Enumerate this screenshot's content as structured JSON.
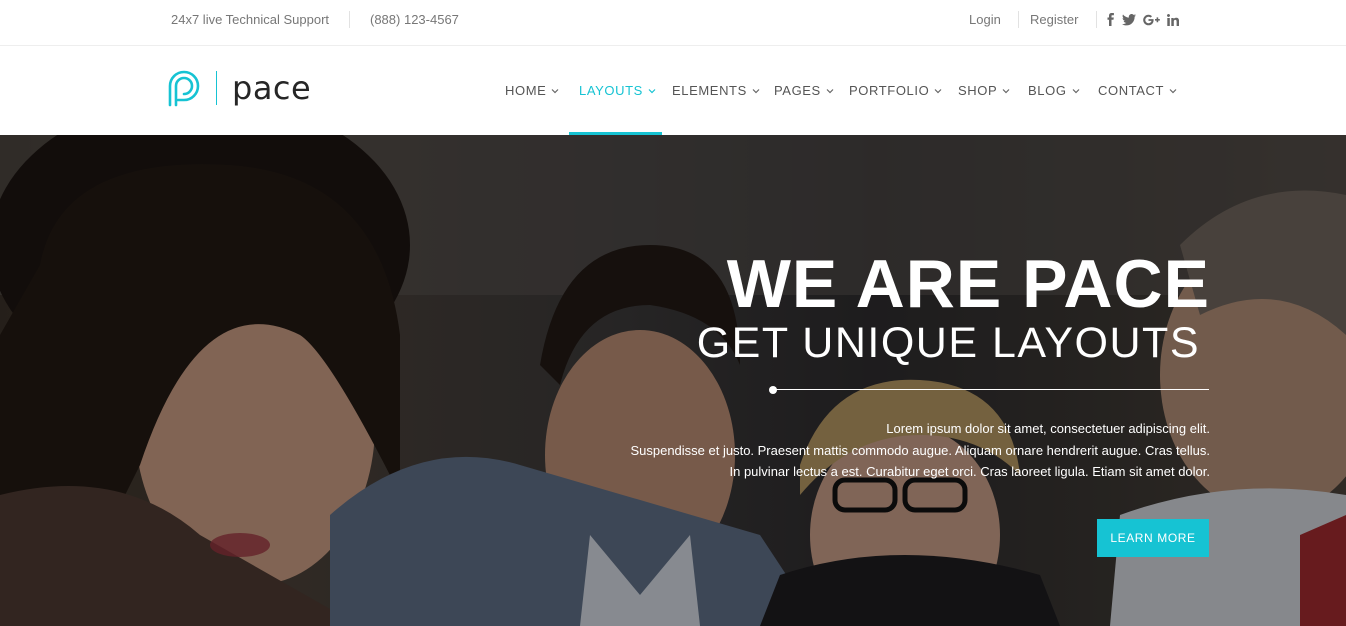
{
  "topbar": {
    "support_text": "24x7 live Technical Support",
    "phone": "(888) 123-4567",
    "login": "Login",
    "register": "Register",
    "social": [
      "facebook-icon",
      "twitter-icon",
      "google-plus-icon",
      "linkedin-icon"
    ]
  },
  "header": {
    "logo_text": "pace",
    "nav": [
      {
        "label": "HOME",
        "active": false
      },
      {
        "label": "LAYOUTS",
        "active": true
      },
      {
        "label": "ELEMENTS",
        "active": false
      },
      {
        "label": "PAGES",
        "active": false
      },
      {
        "label": "PORTFOLIO",
        "active": false
      },
      {
        "label": "SHOP",
        "active": false
      },
      {
        "label": "BLOG",
        "active": false
      },
      {
        "label": "CONTACT",
        "active": false
      }
    ]
  },
  "hero": {
    "title": "WE ARE PACE",
    "subtitle": "GET UNIQUE LAYOUTS",
    "text_lines": [
      "Lorem ipsum dolor sit amet, consectetuer adipiscing elit.",
      "Suspendisse et justo. Praesent mattis commodo augue. Aliquam ornare hendrerit augue. Cras tellus.",
      "In pulvinar lectus a est. Curabitur eget orci. Cras laoreet ligula. Etiam sit amet dolor."
    ],
    "button": "LEARN MORE"
  },
  "colors": {
    "accent": "#16c3d3",
    "nav_text": "#555555",
    "topbar_text": "#777777"
  }
}
